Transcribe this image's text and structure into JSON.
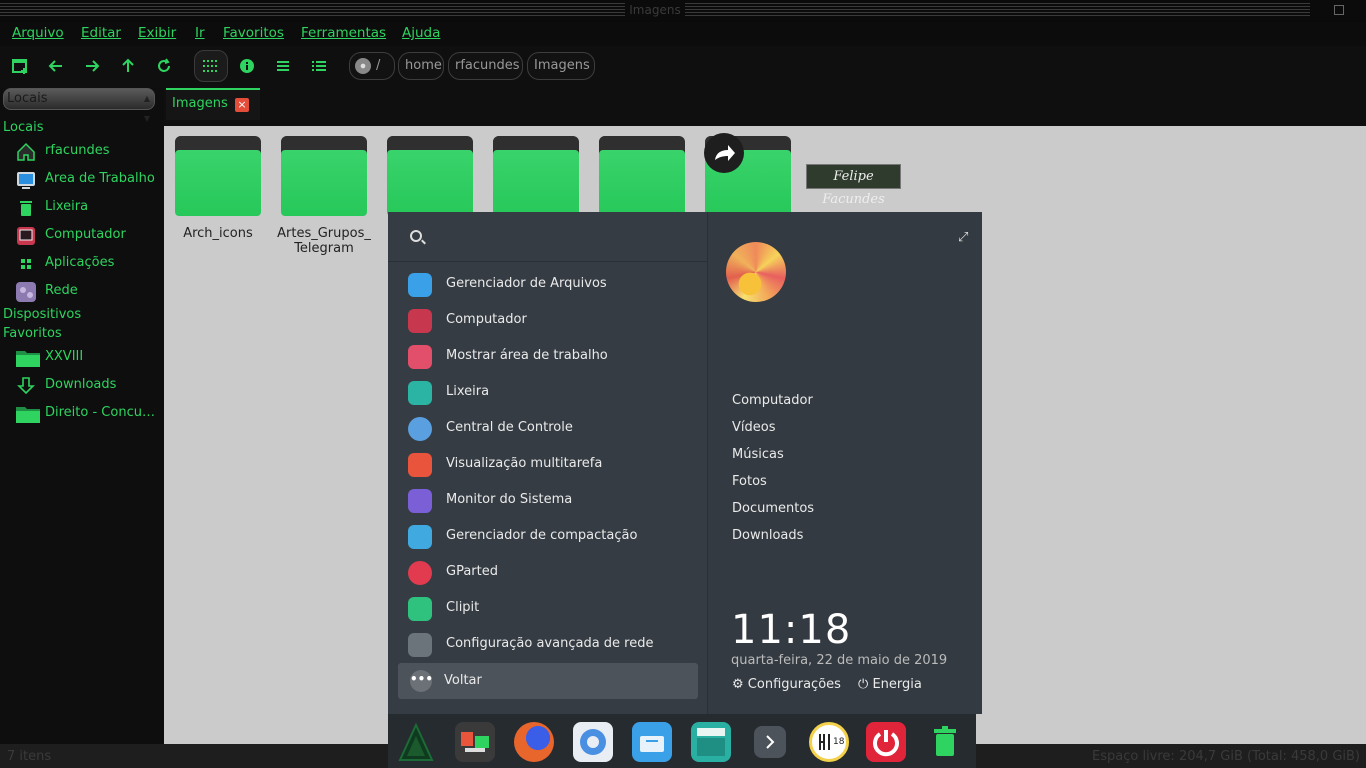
{
  "window": {
    "title": "Imagens"
  },
  "menu": [
    "Arquivo",
    "Editar",
    "Exibir",
    "Ir",
    "Favoritos",
    "Ferramentas",
    "Ajuda"
  ],
  "toolbar": {
    "icons": [
      "new-tab-icon",
      "back-arrow-icon",
      "forward-arrow-icon",
      "up-arrow-icon",
      "reload-icon",
      "grid-view-icon",
      "info-icon",
      "list-view-icon",
      "compact-view-icon"
    ],
    "breadcrumbs": [
      "/",
      "home",
      "rfacundes",
      "Imagens"
    ]
  },
  "sidebar": {
    "combo": "Locais",
    "sections": {
      "locais": "Locais",
      "dispositivos": "Dispositivos",
      "favoritos": "Favoritos"
    },
    "locais": [
      {
        "label": "rfacundes",
        "icon": "home-icon"
      },
      {
        "label": "Área de Trabalho",
        "icon": "desktop-icon"
      },
      {
        "label": "Lixeira",
        "icon": "trash-icon"
      },
      {
        "label": "Computador",
        "icon": "computer-icon"
      },
      {
        "label": "Aplicações",
        "icon": "apps-icon"
      },
      {
        "label": "Rede",
        "icon": "network-icon"
      }
    ],
    "favoritos": [
      {
        "label": "XXVIII",
        "icon": "folder-icon"
      },
      {
        "label": "Downloads",
        "icon": "download-icon"
      },
      {
        "label": "Direito - Concursos",
        "icon": "folder-icon"
      }
    ]
  },
  "tab": {
    "label": "Imagens",
    "close": "×"
  },
  "files": [
    {
      "name": "Arch_icons"
    },
    {
      "name": "Artes_Grupos_ Telegram"
    },
    {
      "name": ""
    },
    {
      "name": ""
    },
    {
      "name": ""
    },
    {
      "name": ""
    }
  ],
  "thumbnail": {
    "text": "Felipe Facundes"
  },
  "status": {
    "left": "7 itens",
    "right": "Espaço livre: 204,7 GiB (Total: 458,0 GiB)"
  },
  "launcher": {
    "apps": [
      {
        "label": "Gerenciador de Arquivos",
        "color": "#3aa0e8"
      },
      {
        "label": "Computador",
        "color": "#c7384f"
      },
      {
        "label": "Mostrar área de trabalho",
        "color": "#e24f6a"
      },
      {
        "label": "Lixeira",
        "color": "#2bb3a3"
      },
      {
        "label": "Central de Controle",
        "color": "#5a9fe0"
      },
      {
        "label": "Visualização multitarefa",
        "color": "#e8553c"
      },
      {
        "label": "Monitor do Sistema",
        "color": "#7b5fd6"
      },
      {
        "label": "Gerenciador de compactação",
        "color": "#3fa9e0"
      },
      {
        "label": "GParted",
        "color": "#e23b4f"
      },
      {
        "label": "Clipit",
        "color": "#2ec27e"
      },
      {
        "label": "Configuração avançada de rede",
        "color": "#6b737b"
      }
    ],
    "voltar": "Voltar",
    "dots": "•••",
    "expand": "⤢",
    "places": [
      "Computador",
      "Vídeos",
      "Músicas",
      "Fotos",
      "Documentos",
      "Downloads"
    ],
    "clock": "11:18",
    "date": "quarta-feira, 22 de maio de 2019",
    "settings": "Configurações",
    "power": "Energia"
  },
  "dock": [
    {
      "name": "arch-launcher-icon",
      "color": "#0f3a1f"
    },
    {
      "name": "multitask-icon",
      "color": "#3a3a3a"
    },
    {
      "name": "firefox-icon",
      "color": "#e8662b"
    },
    {
      "name": "settings-icon",
      "color": "#e9eef4"
    },
    {
      "name": "file-manager-icon",
      "color": "#3aa0e8"
    },
    {
      "name": "files-icon",
      "color": "#2ab0a3"
    },
    {
      "name": "chevron-right-icon",
      "color": "#4c535a"
    },
    {
      "name": "clock-icon",
      "color": "#f4d14a"
    },
    {
      "name": "power-icon",
      "color": "#e0243a"
    },
    {
      "name": "trash-icon",
      "color": "#2ed45f"
    }
  ],
  "dock_clock": "18"
}
